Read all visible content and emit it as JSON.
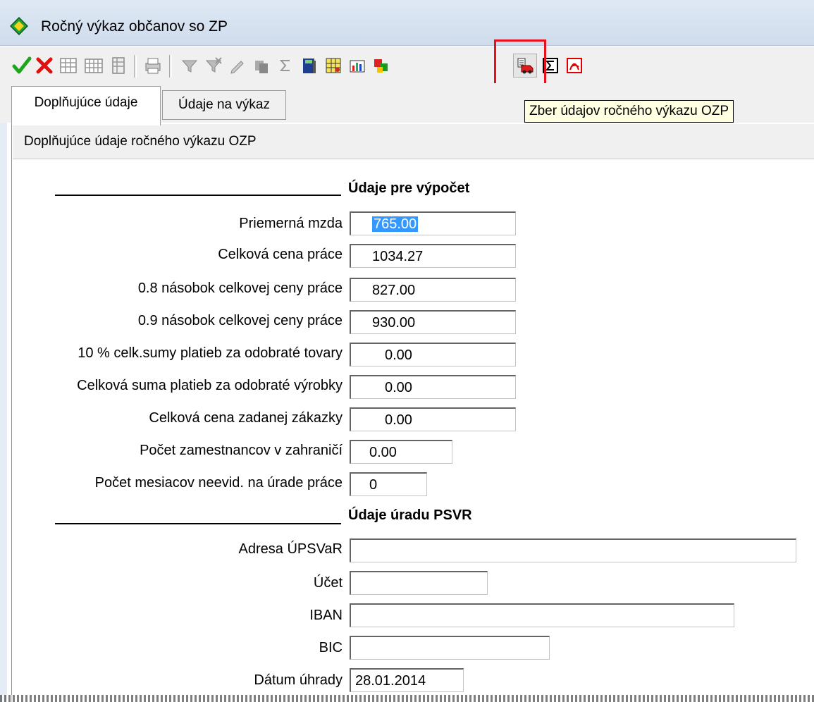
{
  "window": {
    "title": "Ročný výkaz občanov so ZP"
  },
  "toolbar": {
    "buttons": [
      {
        "name": "confirm",
        "icon": "check-icon"
      },
      {
        "name": "cancel",
        "icon": "cross-icon"
      },
      {
        "name": "grid1",
        "icon": "table-icon"
      },
      {
        "name": "grid2",
        "icon": "table-edit-icon"
      },
      {
        "name": "grid3",
        "icon": "table-delete-icon"
      },
      {
        "name": "print",
        "icon": "printer-icon"
      },
      {
        "name": "filter",
        "icon": "filter-icon"
      },
      {
        "name": "filter-clear",
        "icon": "filter-clear-icon"
      },
      {
        "name": "pen",
        "icon": "pen-icon"
      },
      {
        "name": "copy",
        "icon": "copy-icon"
      },
      {
        "name": "sum",
        "icon": "sum-icon"
      },
      {
        "name": "book",
        "icon": "book-icon"
      },
      {
        "name": "calc",
        "icon": "calculator-icon"
      },
      {
        "name": "chart",
        "icon": "chart-icon"
      },
      {
        "name": "blocks",
        "icon": "blocks-icon"
      },
      {
        "name": "collect",
        "icon": "truck-icon"
      },
      {
        "name": "sigma",
        "icon": "sigma-box-icon"
      },
      {
        "name": "pdf",
        "icon": "pdf-icon"
      }
    ],
    "tooltip": "Zber údajov ročného výkazu OZP"
  },
  "tabs": [
    {
      "label": "Doplňujúce údaje",
      "active": true
    },
    {
      "label": "Údaje na výkaz",
      "active": false
    }
  ],
  "panel": {
    "header": "Doplňujúce údaje ročného výkazu OZP",
    "section1": {
      "title": "Údaje pre výpočet",
      "fields": [
        {
          "label": "Priemerná mzda",
          "value": "765.00"
        },
        {
          "label": "Celková cena práce",
          "value": "1034.27"
        },
        {
          "label": "0.8 násobok celkovej ceny práce",
          "value": "827.00"
        },
        {
          "label": "0.9 násobok celkovej ceny práce",
          "value": "930.00"
        },
        {
          "label": "10 % celk.sumy platieb za odobraté tovary",
          "value": "0.00"
        },
        {
          "label": "Celková suma platieb za odobraté výrobky",
          "value": "0.00"
        },
        {
          "label": "Celková cena zadanej zákazky",
          "value": "0.00"
        },
        {
          "label": "Počet zamestnancov v zahraničí",
          "value": "0.00"
        },
        {
          "label": "Počet mesiacov neevid. na úrade práce",
          "value": "0"
        }
      ]
    },
    "section2": {
      "title": "Údaje úradu PSVR",
      "fields": [
        {
          "label": "Adresa ÚPSVaR",
          "value": ""
        },
        {
          "label": "Účet",
          "value": ""
        },
        {
          "label": "IBAN",
          "value": ""
        },
        {
          "label": "BIC",
          "value": ""
        },
        {
          "label": "Dátum úhrady",
          "value": "28.01.2014"
        }
      ]
    }
  }
}
